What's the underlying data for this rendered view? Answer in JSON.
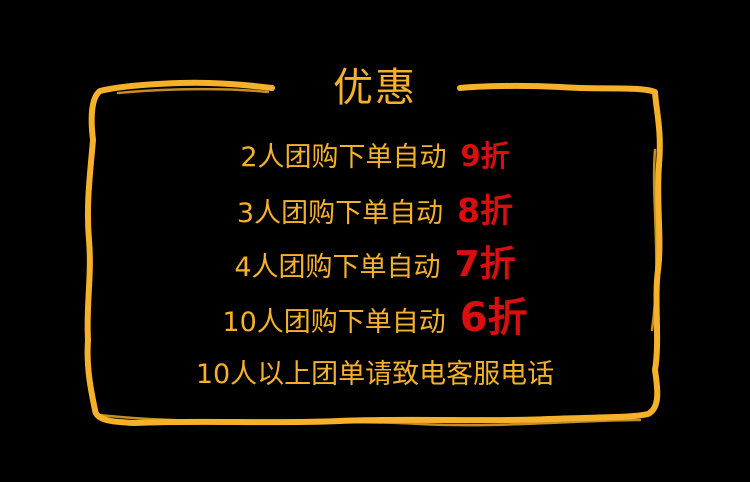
{
  "title": "优惠",
  "rows": [
    {
      "text": "2人团购下单自动",
      "discount": "9折"
    },
    {
      "text": "3人团购下单自动",
      "discount": "8折"
    },
    {
      "text": "4人团购下单自动",
      "discount": "7折"
    },
    {
      "text": "10人团购下单自动",
      "discount": "6折"
    }
  ],
  "footer": "10人以上团单请致电客服电话",
  "colors": {
    "background": "#000000",
    "accent": "#f6b12a",
    "discount": "#d90f0f"
  }
}
